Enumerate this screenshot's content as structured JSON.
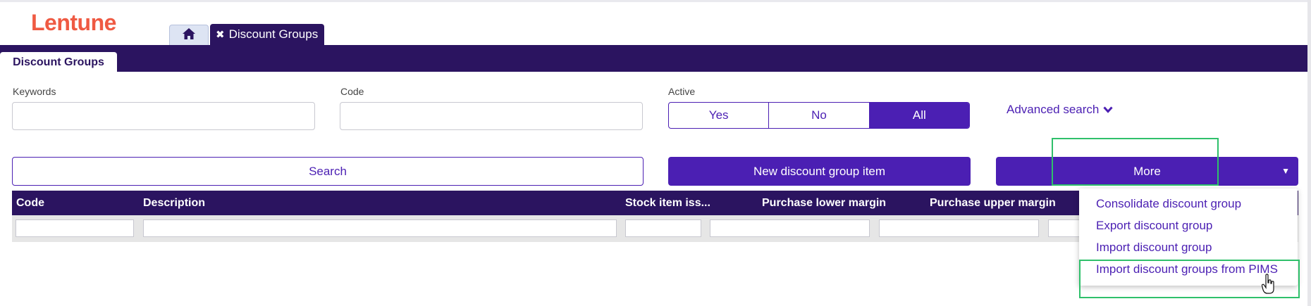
{
  "app": {
    "logo": "Lentune"
  },
  "tabs": {
    "home_icon": "home-icon",
    "close_symbol": "✖",
    "document_tab": "Discount Groups"
  },
  "subtab": {
    "label": "Discount Groups"
  },
  "filters": {
    "keywords_label": "Keywords",
    "keywords_value": "",
    "code_label": "Code",
    "code_value": "",
    "active_label": "Active",
    "active_options": [
      "Yes",
      "No",
      "All"
    ],
    "active_selected": "All",
    "advanced_search": "Advanced search"
  },
  "actions": {
    "search": "Search",
    "new_item": "New discount group item",
    "more": "More"
  },
  "grid": {
    "columns": [
      "Code",
      "Description",
      "Stock item iss...",
      "Purchase lower margin",
      "Purchase upper margin"
    ]
  },
  "more_menu": {
    "items": [
      "Consolidate discount group",
      "Export discount group",
      "Import discount group",
      "Import discount groups from PIMS"
    ]
  },
  "colors": {
    "brand": "#ef5a43",
    "primary": "#4b1fb3",
    "header": "#2b1460",
    "highlight": "#2fc06b"
  }
}
